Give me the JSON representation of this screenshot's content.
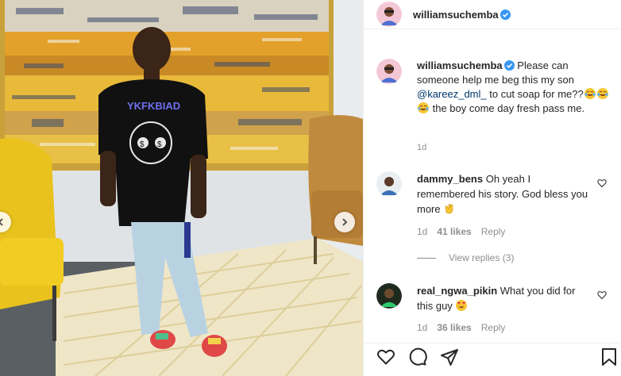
{
  "post": {
    "username": "williamsuchemba",
    "verified": true
  },
  "caption": {
    "username": "williamsuchemba",
    "text_part1": "Please can someone help me beg this my son ",
    "mention": "@kareez_dml_",
    "text_part2": " to cut soap for me??",
    "text_part3": " the boy come day fresh pass me.",
    "emoji": "tears-of-joy",
    "time": "1d"
  },
  "comments": [
    {
      "username": "dammy_bens",
      "text": "Oh yeah I remembered his story. God bless you more",
      "emoji": "clapping-hands",
      "time": "1d",
      "likes": "41 likes",
      "reply_label": "Reply",
      "view_replies": "View replies (3)"
    },
    {
      "username": "real_ngwa_pikin",
      "text": "What you did for this guy",
      "emoji": "heart-eyes",
      "time": "1d",
      "likes": "36 likes",
      "reply_label": "Reply"
    }
  ],
  "actions": [
    "heart-icon",
    "comment-icon",
    "share-icon",
    "bookmark-icon"
  ],
  "colors": {
    "text": "#262626",
    "muted": "#8e8e8e",
    "mention": "#00376b",
    "verified": "#3897f0",
    "border": "#efefef"
  }
}
